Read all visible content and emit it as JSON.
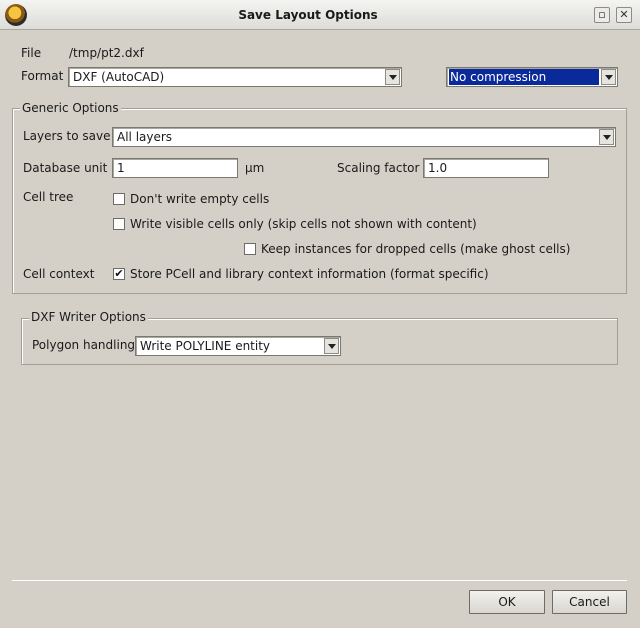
{
  "window": {
    "title": "Save Layout Options",
    "app_icon": "klayout-icon",
    "controls": [
      "restore-icon",
      "close-icon"
    ]
  },
  "file": {
    "label": "File",
    "value": "/tmp/pt2.dxf"
  },
  "format": {
    "label": "Format",
    "value": "DXF (AutoCAD)",
    "compression": "No compression"
  },
  "generic": {
    "title": "Generic Options",
    "layers_label": "Layers to save",
    "layers_value": "All layers",
    "dbu_label": "Database unit",
    "dbu_value": "1",
    "dbu_unit": "µm",
    "scaling_label": "Scaling factor",
    "scaling_value": "1.0",
    "cell_tree_label": "Cell tree",
    "no_empty_cells": {
      "label": "Don't write empty cells",
      "checked": false
    },
    "visible_only": {
      "label": "Write visible cells only (skip cells not shown with content)",
      "checked": false
    },
    "ghost_cells": {
      "label": "Keep instances for dropped cells (make ghost cells)",
      "checked": false
    },
    "cell_context_label": "Cell context",
    "store_context": {
      "label": "Store PCell and library context information (format specific)",
      "checked": true
    }
  },
  "dxf": {
    "title": "DXF Writer Options",
    "polygon_label": "Polygon handling",
    "polygon_value": "Write POLYLINE entity"
  },
  "buttons": {
    "ok": "OK",
    "cancel": "Cancel"
  }
}
